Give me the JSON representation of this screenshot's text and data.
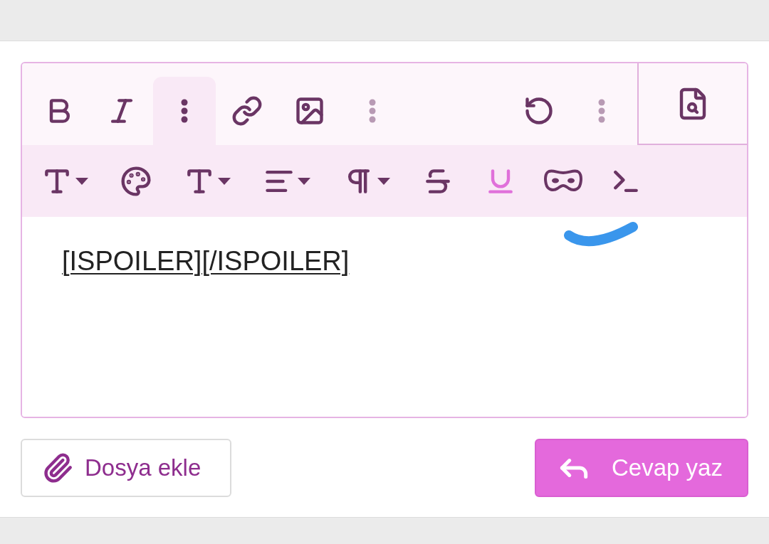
{
  "toolbar_row_1_left": [
    {
      "kind": "bold",
      "active": false,
      "disabled": false
    },
    {
      "kind": "italic",
      "active": false,
      "disabled": false
    },
    {
      "kind": "more",
      "active": true,
      "disabled": false
    },
    {
      "kind": "link",
      "active": false,
      "disabled": false
    },
    {
      "kind": "image",
      "active": false,
      "disabled": false
    },
    {
      "kind": "more",
      "active": false,
      "disabled": true
    }
  ],
  "toolbar_row_1_right": [
    {
      "kind": "undo",
      "active": false,
      "disabled": false
    },
    {
      "kind": "more",
      "active": false,
      "disabled": true
    }
  ],
  "preview_button": {
    "active": false
  },
  "toolbar_row_2": [
    {
      "kind": "text-size",
      "active": false
    },
    {
      "kind": "color",
      "active": false
    },
    {
      "kind": "font",
      "active": false
    },
    {
      "kind": "align",
      "active": false
    },
    {
      "kind": "paragraph",
      "active": false
    },
    {
      "kind": "strike",
      "active": false
    },
    {
      "kind": "underline",
      "active": true
    },
    {
      "kind": "spoiler",
      "active": false
    },
    {
      "kind": "code",
      "active": false
    }
  ],
  "editor": {
    "value": "[ISPOILER][/ISPOILER]",
    "underlined": true
  },
  "attach_button": {
    "label": "Dosya ekle"
  },
  "submit_button": {
    "label": "Cevap yaz"
  }
}
